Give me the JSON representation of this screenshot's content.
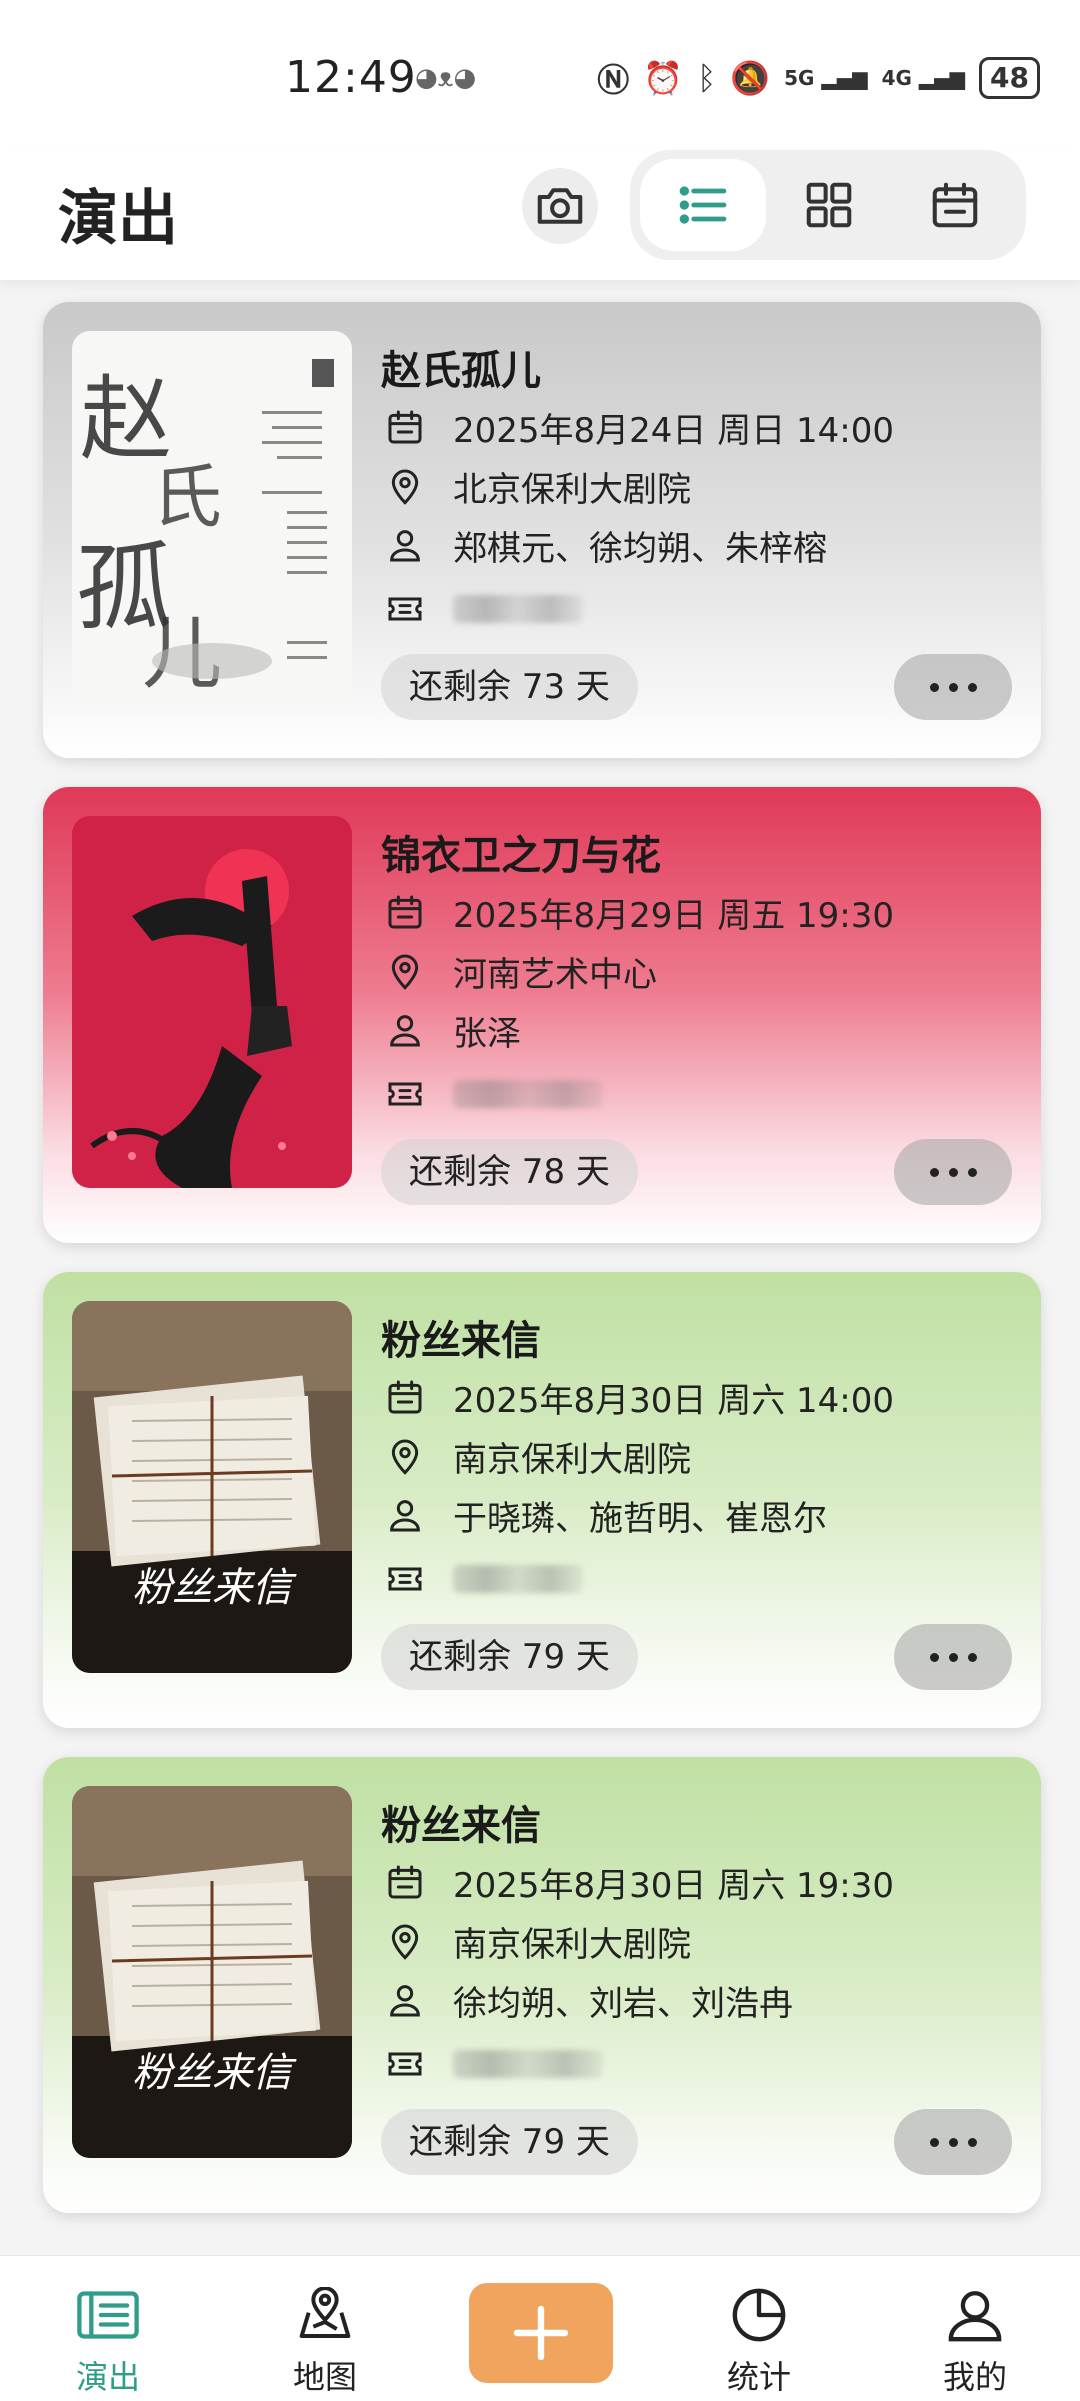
{
  "status_bar": {
    "time": "12:49",
    "net1": "5G",
    "net2": "4G",
    "battery": "48"
  },
  "header": {
    "title": "演出"
  },
  "shows": [
    {
      "title": "赵氏孤儿",
      "datetime": "2025年8月24日 周日 14:00",
      "venue": "北京保利大剧院",
      "cast": "郑棋元、徐均朔、朱梓榕",
      "days_left": "还剩余 73 天",
      "theme": "gray",
      "poster_text": "赵氏孤儿"
    },
    {
      "title": "锦衣卫之刀与花",
      "datetime": "2025年8月29日 周五 19:30",
      "venue": "河南艺术中心",
      "cast": "张泽",
      "days_left": "还剩余 78 天",
      "theme": "red"
    },
    {
      "title": "粉丝来信",
      "datetime": "2025年8月30日 周六 14:00",
      "venue": "南京保利大剧院",
      "cast": "于晓璘、施哲明、崔恩尔",
      "days_left": "还剩余 79 天",
      "theme": "green",
      "poster_text": "粉丝来信"
    },
    {
      "title": "粉丝来信",
      "datetime": "2025年8月30日 周六 19:30",
      "venue": "南京保利大剧院",
      "cast": "徐均朔、刘岩、刘浩冉",
      "days_left": "还剩余 79 天",
      "theme": "green",
      "poster_text": "粉丝来信"
    }
  ],
  "nav": {
    "shows": "演出",
    "map": "地图",
    "stats": "统计",
    "mine": "我的"
  },
  "colors": {
    "accent": "#2f9d8a",
    "add_button": "#f0a45e"
  }
}
